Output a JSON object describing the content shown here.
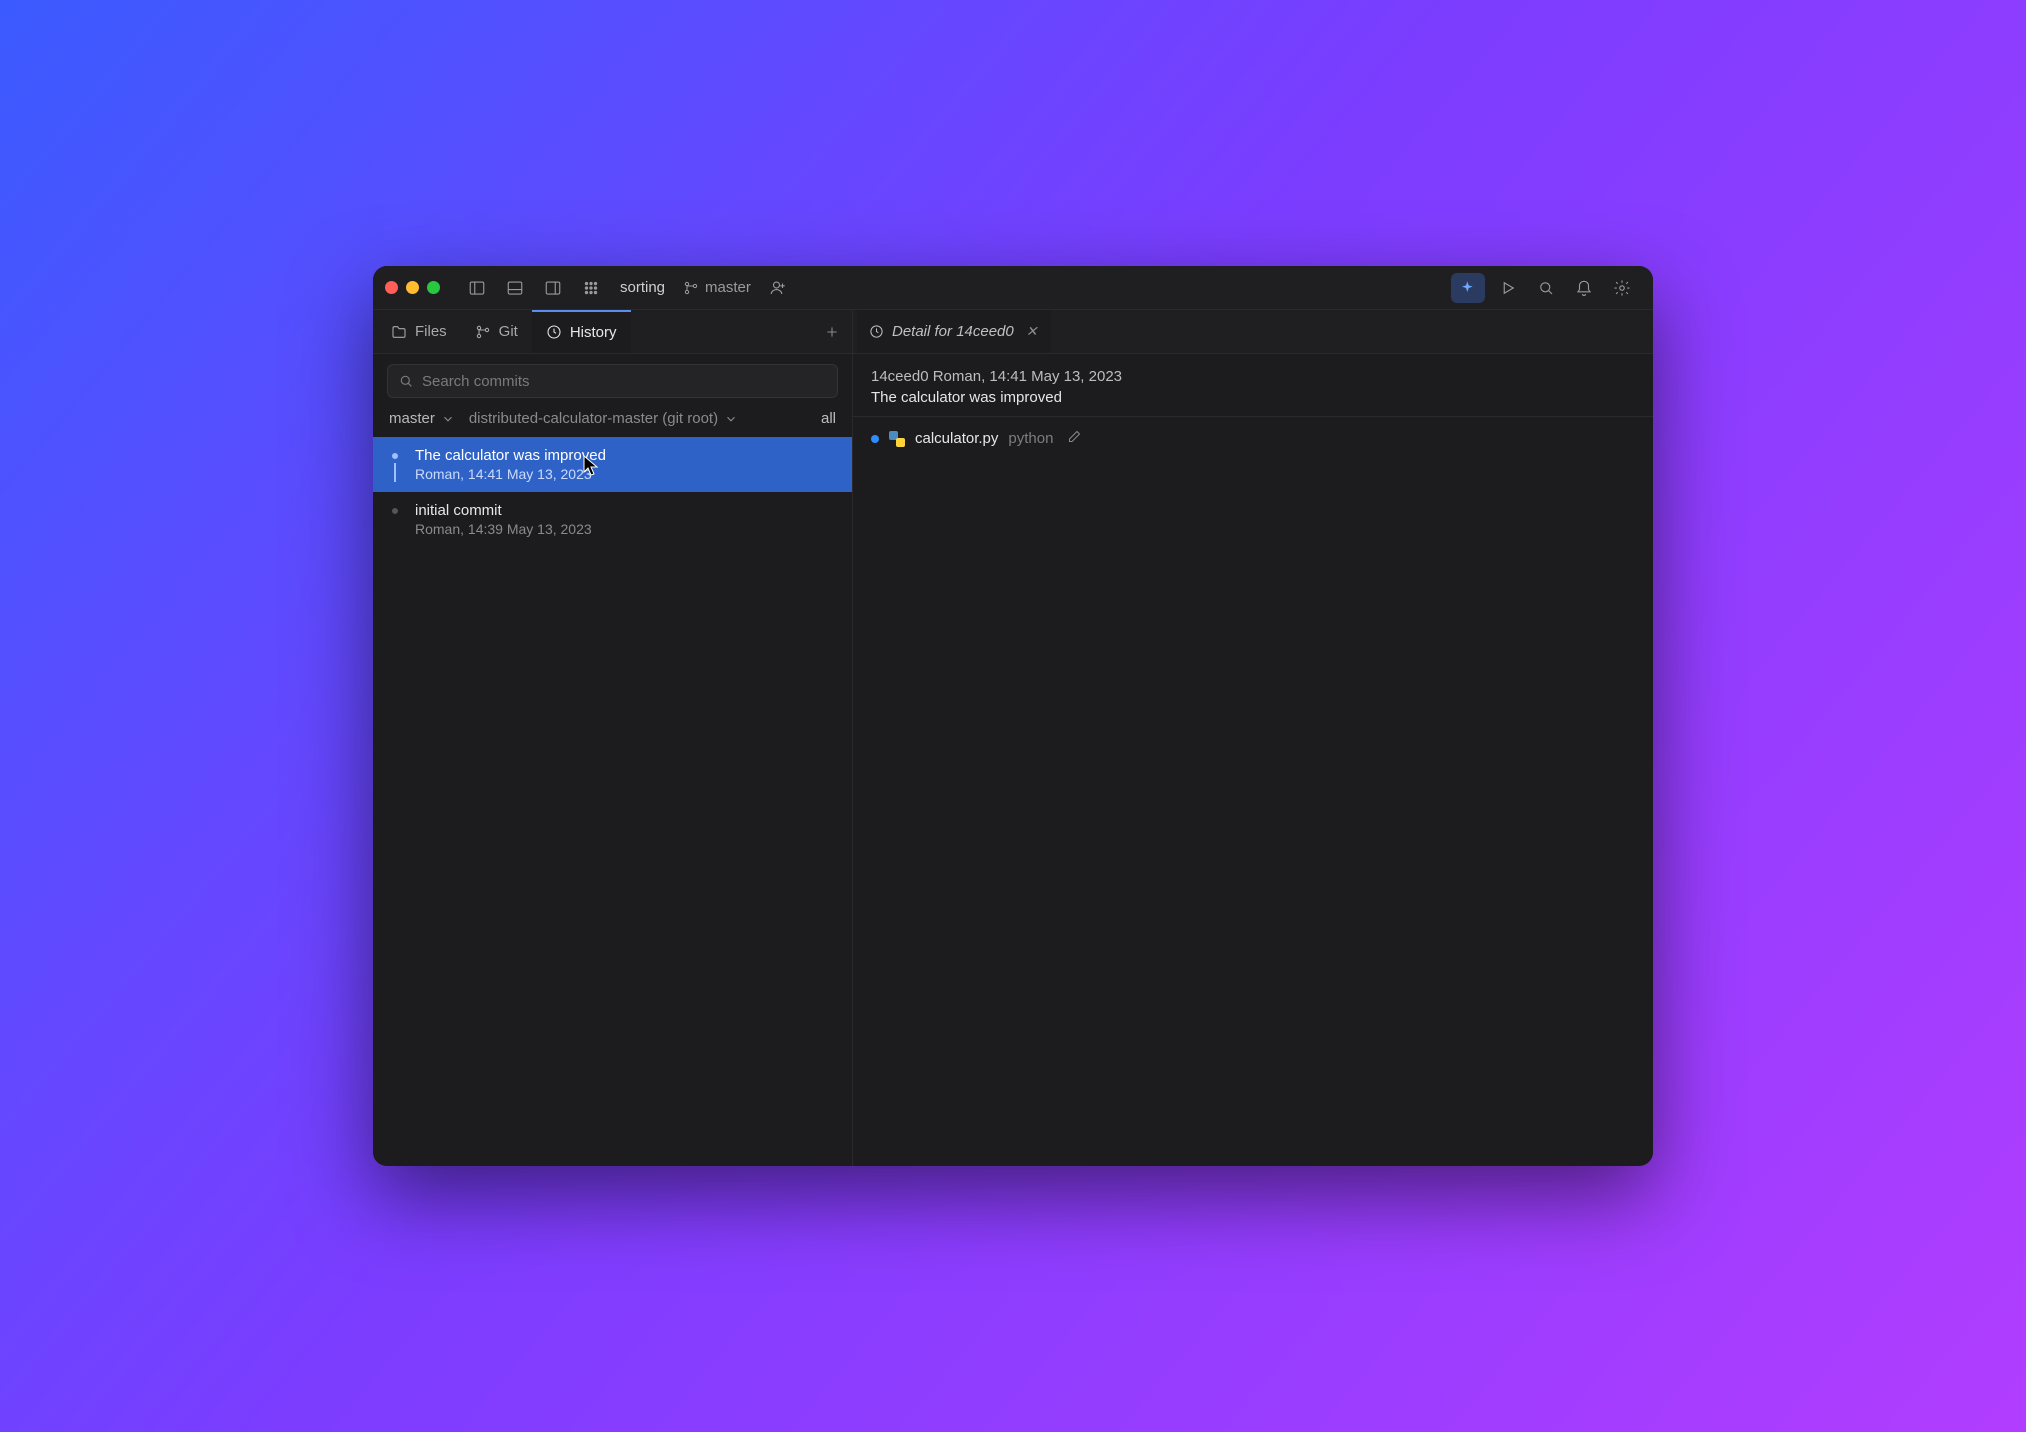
{
  "titlebar": {
    "project": "sorting",
    "branch": "master"
  },
  "sidebar_tabs": {
    "files": "Files",
    "git": "Git",
    "history": "History"
  },
  "search": {
    "placeholder": "Search commits"
  },
  "filters": {
    "branch": "master",
    "root": "distributed-calculator-master (git root)",
    "all": "all"
  },
  "commits": [
    {
      "title": "The calculator was improved",
      "meta": "Roman, 14:41 May 13, 2023",
      "selected": true
    },
    {
      "title": "initial commit",
      "meta": "Roman, 14:39 May 13, 2023",
      "selected": false
    }
  ],
  "detail": {
    "tab_title": "Detail for 14ceed0",
    "header_line": "14ceed0 Roman, 14:41 May 13, 2023",
    "message": "The calculator was improved",
    "files": [
      {
        "name": "calculator.py",
        "dir": "python"
      }
    ]
  }
}
